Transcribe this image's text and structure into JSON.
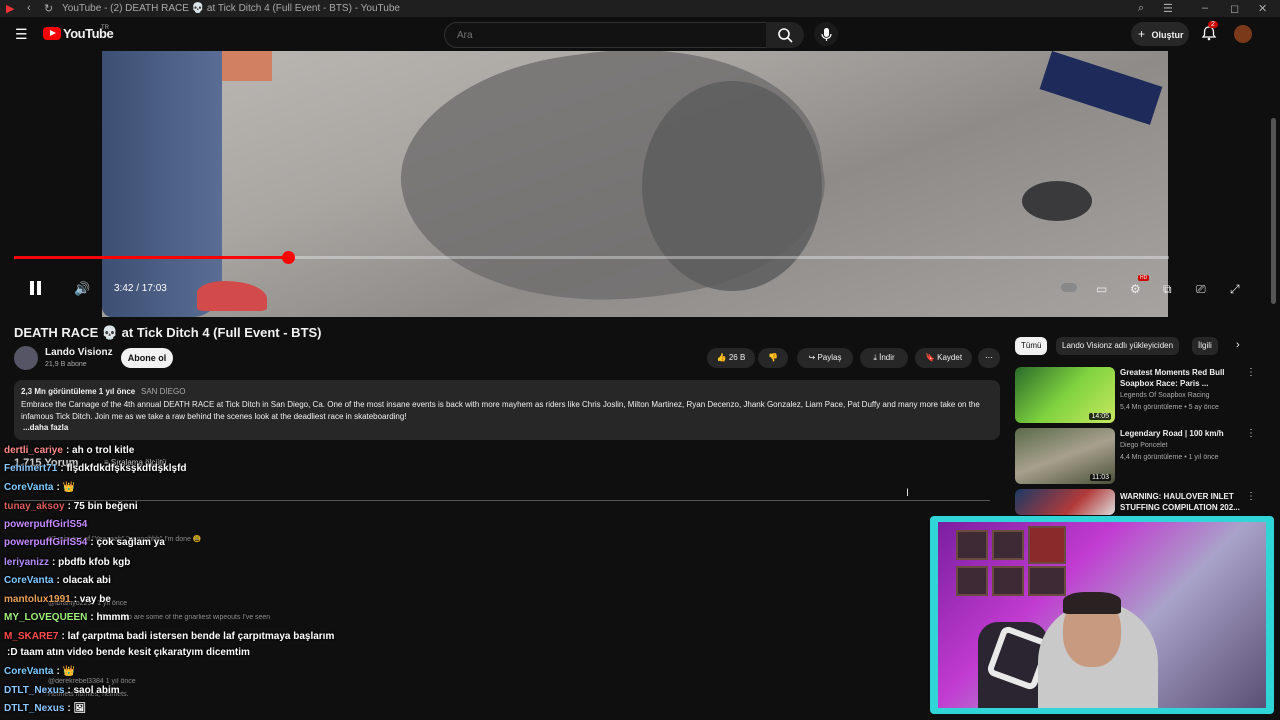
{
  "window": {
    "title": "YouTube - (2) DEATH RACE 💀 at Tick Ditch 4 (Full Event - BTS) - YouTube"
  },
  "header": {
    "logo": "YouTube",
    "logo_region": "TR",
    "search_placeholder": "Ara",
    "create_label": "Oluştur",
    "notification_count": "2"
  },
  "player": {
    "time": "3:42 / 17:03",
    "progress": 0.237,
    "hd_badge": "HD"
  },
  "video": {
    "title": "DEATH RACE 💀 at Tick Ditch 4 (Full Event - BTS)",
    "channel": "Lando Visionz",
    "subscribers": "21,9 B abone",
    "subscribe_label": "Abone ol",
    "likes": "26 B",
    "share_label": "Paylaş",
    "download_label": "İndir",
    "save_label": "Kaydet"
  },
  "description": {
    "stats": "2,3 Mn görüntüleme  1 yıl önce",
    "location": "SAN DİEGO",
    "text": "Embrace the Carnage of the 4th annual DEATH RACE at Tick Ditch in San Diego, Ca. One of the most insane events is back with more mayhem as riders like Chris Joslin, Milton Martinez, Ryan Decenzo, Jhank Gonzalez, Liam Pace, Pat Duffy and many more take on the infamous Tick Ditch. Join me as we take a raw behind the scenes look at the deadliest race in skateboarding!",
    "more": "...daha fazla"
  },
  "comments": {
    "count": "1.715 Yorum",
    "sort": "Sıralama ölçütü"
  },
  "chat": [
    {
      "user": "dertli_cariye",
      "color": "#ff8a8a",
      "text": ": ah o trol kitle"
    },
    {
      "user": "Fehimert71",
      "color": "#8dc8ff",
      "text": ": flşdkfdkdfşksşkdfdşklşfd"
    },
    {
      "user": "CoreVanta",
      "color": "#7ecbff",
      "text": ": 👑"
    },
    {
      "user": "tunay_aksoy",
      "color": "#d95b5b",
      "text": ": 75 bin beğeni"
    },
    {
      "user": "powerpuffGirlS54",
      "color": "#c48cff",
      "text": ""
    },
    {
      "user": "powerpuffGirlS54",
      "color": "#c48cff",
      "text": ": çok sağlam ya"
    },
    {
      "user": "leriyanizz",
      "color": "#b58cff",
      "text": ": pbdfb kfob kgb"
    },
    {
      "user": "CoreVanta",
      "color": "#7ecbff",
      "text": ": olacak abi"
    },
    {
      "user": "mantolux1991",
      "color": "#e6a25a",
      "text": ": vay be"
    },
    {
      "user": "MY_LOVEQUEEN",
      "color": "#9ef07a",
      "text": ": hmmm"
    },
    {
      "user": "M_SKARE7",
      "color": "#ff4a4a",
      "text": ": laf çarpıtma badi istersen bende laf çarpıtmaya başlarım"
    },
    {
      "user": "",
      "color": "#ffffff",
      "text": ":D taam atın video bende kesit çıkaratyım dicemtim"
    },
    {
      "user": "CoreVanta",
      "color": "#7ecbff",
      "text": ": 👑"
    },
    {
      "user": "DTLT_Nexus",
      "color": "#8dc8ff",
      "text": ": saol abim"
    },
    {
      "user": "DTLT_Nexus",
      "color": "#8dc8ff",
      "text": ": 🖼"
    }
  ],
  "ghost_text": [
    "17 minutes of \"Yeaaaah\" \"ooooohhh\" I'm done 😩",
    "@ibrahiyo2237  1 yıl önce",
    "This video are some of the gnarliest wipeouts I've seen",
    "@derekrebel3384  1 yıl önce",
    "Helmets homies, helmets."
  ],
  "chips": [
    "Tümü",
    "Lando Visionz adlı yükleyiciden",
    "İlgili"
  ],
  "recommended": [
    {
      "title": "Greatest Moments Red Bull Soapbox Race: Paris ...",
      "channel": "Legends Of Soapbox Racing",
      "meta": "5,4 Mn görüntüleme • 5 ay önce",
      "duration": "14:05"
    },
    {
      "title": "Legendary Road | 100 km/h",
      "channel": "Diego Poncelet",
      "meta": "4,4 Mn görüntüleme • 1 yıl önce",
      "duration": "11:03"
    },
    {
      "title": "WARNING: HAULOVER INLET STUFFING COMPILATION 202...",
      "channel": "",
      "meta": "",
      "duration": ""
    }
  ],
  "colors": {
    "accent": "#ff0000",
    "webcam_border": "#30d5d8"
  }
}
